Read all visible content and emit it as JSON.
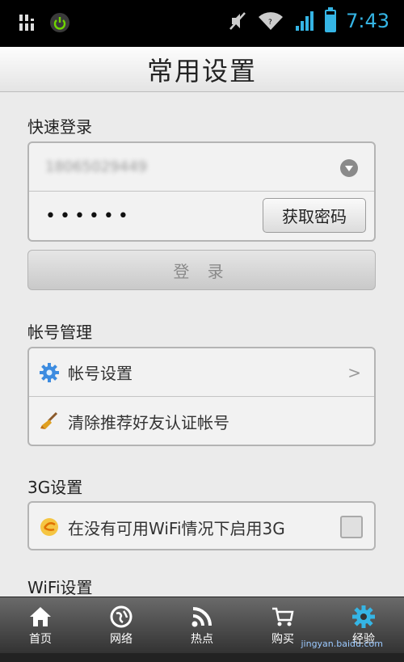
{
  "status_bar": {
    "time": "7:43",
    "battery_level": 0.85
  },
  "title": "常用设置",
  "quick_login": {
    "label": "快速登录",
    "account_value": "18065029449",
    "password_value": "••••••",
    "get_password_label": "获取密码",
    "login_label": "登 录"
  },
  "account_mgmt": {
    "label": "帐号管理",
    "items": [
      {
        "label": "帐号设置",
        "icon": "gear-icon",
        "chevron": ">"
      },
      {
        "label": "清除推荐好友认证帐号",
        "icon": "broom-icon"
      }
    ]
  },
  "g3_settings": {
    "label": "3G设置",
    "option_label": "在没有可用WiFi情况下启用3G",
    "checked": false
  },
  "wifi_settings": {
    "label": "WiFi设置"
  },
  "bottom_nav": [
    {
      "label": "首页",
      "icon": "home-icon"
    },
    {
      "label": "网络",
      "icon": "globe-icon"
    },
    {
      "label": "热点",
      "icon": "rss-icon"
    },
    {
      "label": "购买",
      "icon": "cart-icon"
    },
    {
      "label": "经验",
      "icon": "gear-icon"
    }
  ],
  "watermark": "jingyan.baidu.com"
}
